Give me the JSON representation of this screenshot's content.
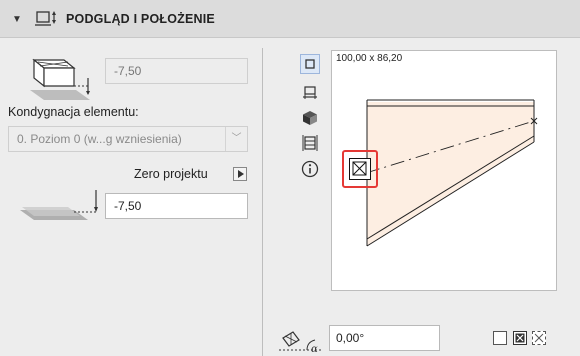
{
  "header": {
    "title": "PODGLĄD I POŁOŻENIE",
    "collapse_icon": "chevron-down-icon",
    "panel_icon": "preview-position-icon"
  },
  "left_panel": {
    "elevation_value": "-7,50",
    "story_label": "Kondygnacja elementu:",
    "story_select_value": "0. Poziom 0 (w...g wzniesienia)",
    "zero_label": "Zero projektu",
    "zero_value": "-7,50"
  },
  "view_tools": [
    {
      "name": "plan-view-icon",
      "active": true
    },
    {
      "name": "section-view-icon",
      "active": false
    },
    {
      "name": "3d-view-icon",
      "active": false
    },
    {
      "name": "elevation-view-icon",
      "active": false
    },
    {
      "name": "info-icon",
      "active": false
    }
  ],
  "preview": {
    "dimensions": "100,00 x 86,20",
    "fill_color": "#fdeee2",
    "highlight_color": "#e53935"
  },
  "bottom": {
    "angle_value": "0,00°",
    "angle_icon": "rotation-angle-icon",
    "checkbox_icons": [
      "empty-checkbox-icon",
      "mirror-checkbox-icon",
      "mirror-dashed-icon"
    ]
  }
}
